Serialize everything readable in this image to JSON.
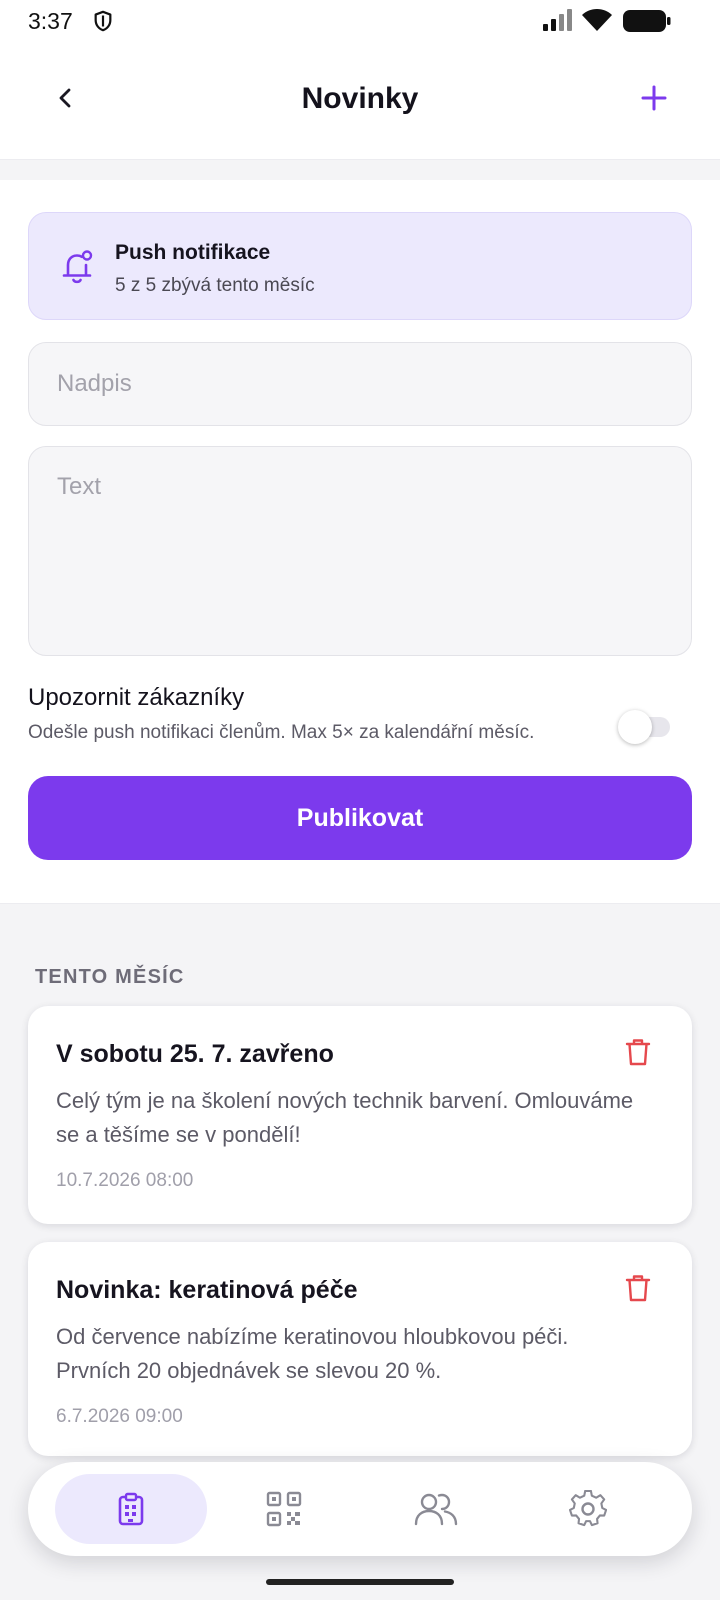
{
  "status_bar": {
    "time": "3:37",
    "icons": [
      "shield-icon",
      "signal-icon",
      "wifi-icon",
      "battery-icon"
    ]
  },
  "header": {
    "title": "Novinky",
    "back_icon": "chevron-left-icon",
    "add_icon": "plus-icon"
  },
  "push_info": {
    "icon": "bell-icon",
    "title": "Push notifikace",
    "subtitle": "5 z 5 zbývá tento měsíc"
  },
  "form": {
    "title_placeholder": "Nadpis",
    "text_placeholder": "Text",
    "notify_label": "Upozornit zákazníky",
    "notify_description": "Odešle push notifikaci členům. Max 5× za kalendářní měsíc.",
    "notify_enabled": false,
    "publish_label": "Publikovat"
  },
  "news": {
    "section_label": "TENTO MĚSÍC",
    "items": [
      {
        "title": "V sobotu 25. 7. zavřeno",
        "body": "Celý tým je na školení nových technik barvení. Omlouváme se a těšíme se v pondělí!",
        "date": "10.7.2026 08:00"
      },
      {
        "title": "Novinka: keratinová péče",
        "body": "Od července nabízíme keratinovou hloubkovou péči. Prvních 20 objednávek se slevou 20 %.",
        "date": "6.7.2026 09:00"
      }
    ]
  },
  "bottom_nav": {
    "items": [
      {
        "icon": "clipboard-icon",
        "active": true
      },
      {
        "icon": "qr-code-icon",
        "active": false
      },
      {
        "icon": "users-icon",
        "active": false
      },
      {
        "icon": "gear-icon",
        "active": false
      }
    ]
  },
  "colors": {
    "accent": "#7c3aed",
    "accent_light": "#ece9fd",
    "delete": "#e5484d",
    "text_primary": "#16141f",
    "text_secondary": "#5c5a66"
  }
}
